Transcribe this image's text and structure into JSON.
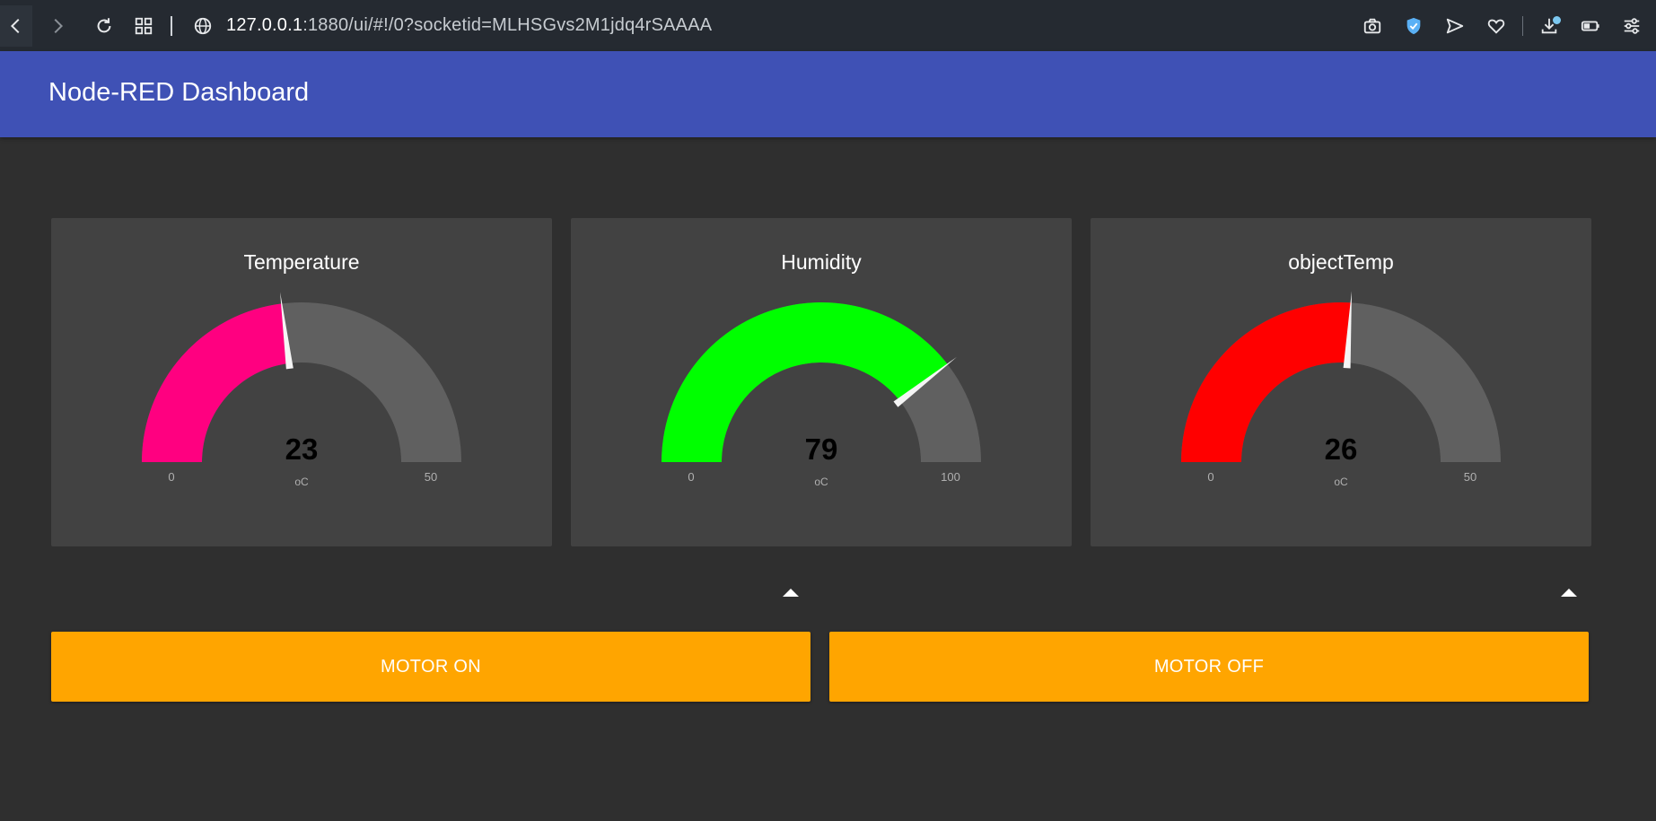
{
  "browser": {
    "url_host": "127.0.0.1",
    "url_rest": ":1880/ui/#!/0?socketid=MLHSGvs2M1jdq4rSAAAA",
    "icons": [
      "back-icon",
      "forward-icon",
      "reload-icon",
      "grid-icon",
      "globe-icon",
      "camera-icon",
      "shield-icon",
      "send-icon",
      "heart-icon",
      "download-icon",
      "battery-icon",
      "settings-icon"
    ]
  },
  "header": {
    "title": "Node-RED Dashboard",
    "color": "#3f51b5"
  },
  "gauges": [
    {
      "title": "Temperature",
      "value_text": "23",
      "value": 23,
      "min": 0,
      "max": 50,
      "min_label": "0",
      "max_label": "50",
      "units": "oC",
      "color": "#ff0080"
    },
    {
      "title": "Humidity",
      "value_text": "79",
      "value": 79,
      "min": 0,
      "max": 100,
      "min_label": "0",
      "max_label": "100",
      "units": "oC",
      "color": "#00ff00"
    },
    {
      "title": "objectTemp",
      "value_text": "26",
      "value": 26,
      "min": 0,
      "max": 50,
      "min_label": "0",
      "max_label": "50",
      "units": "oC",
      "color": "#ff0000"
    }
  ],
  "buttons": {
    "motor_on": "MOTOR ON",
    "motor_off": "MOTOR OFF",
    "color": "#ffa500"
  }
}
